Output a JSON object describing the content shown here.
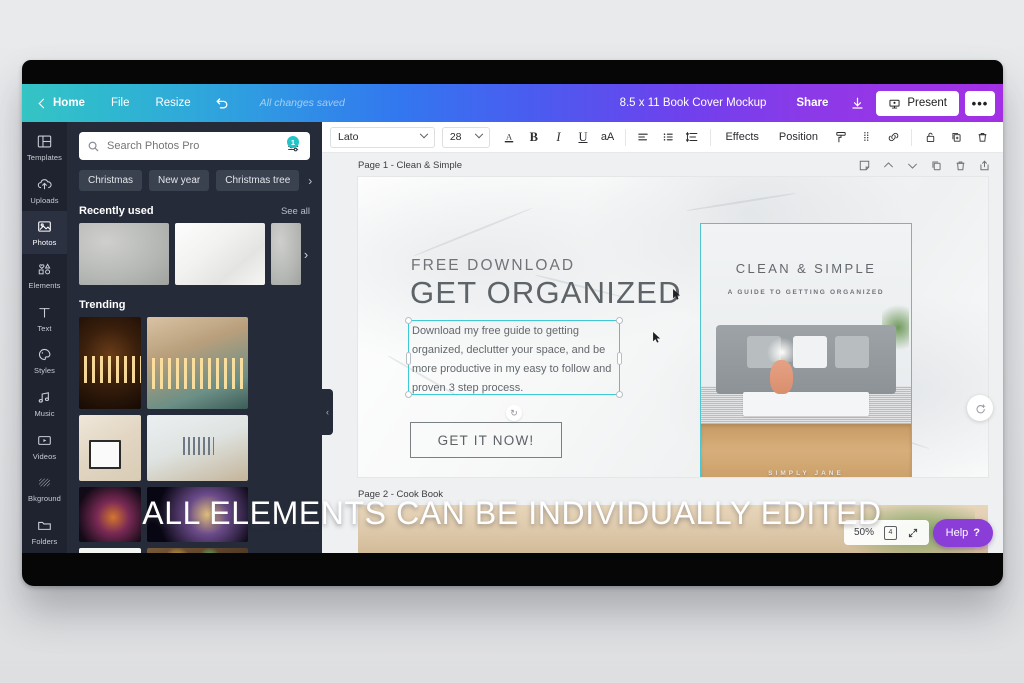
{
  "topbar": {
    "home": "Home",
    "file": "File",
    "resize": "Resize",
    "undo_icon": "undo-icon",
    "saved_status": "All changes saved",
    "doc_title": "8.5 x 11 Book Cover Mockup",
    "share": "Share",
    "download_icon": "download-icon",
    "present": "Present",
    "present_icon": "present-screen-icon",
    "more": "•••",
    "gradient_start": "#35c4c4",
    "gradient_mid": "#3278ef",
    "gradient_end": "#a32fe4"
  },
  "rail": {
    "items": [
      {
        "label": "Templates",
        "icon": "templates-icon",
        "active": false
      },
      {
        "label": "Uploads",
        "icon": "upload-cloud-icon",
        "active": false
      },
      {
        "label": "Photos",
        "icon": "photos-image-icon",
        "active": true
      },
      {
        "label": "Elements",
        "icon": "elements-shapes-icon",
        "active": false
      },
      {
        "label": "Text",
        "icon": "text-t-icon",
        "active": false
      },
      {
        "label": "Styles",
        "icon": "styles-palette-icon",
        "active": false
      },
      {
        "label": "Music",
        "icon": "music-note-icon",
        "active": false
      },
      {
        "label": "Videos",
        "icon": "video-play-icon",
        "active": false
      },
      {
        "label": "Bkground",
        "icon": "background-hatch-icon",
        "active": false
      },
      {
        "label": "Folders",
        "icon": "folder-icon",
        "active": false
      }
    ]
  },
  "panel": {
    "search": {
      "placeholder": "Search Photos Pro",
      "value": "",
      "search_icon": "search-icon",
      "filter_icon": "filter-sliders-icon",
      "filter_badge": "1"
    },
    "chips": [
      "Christmas",
      "New year",
      "Christmas tree"
    ],
    "chip_next_icon": "chevron-right-icon",
    "recently_used": {
      "title": "Recently used",
      "see_all": "See all",
      "thumbs": [
        "gray-marble-texture",
        "white-marble-texture"
      ]
    },
    "trending": {
      "title": "Trending",
      "thumbs": [
        "menorah-candles-dark",
        "girl-lighting-menorah",
        "happy-holidays-card",
        "menorah-on-table",
        "fireworks-colorful",
        "fireworks-gold",
        "happy-paper-letters",
        "bokeh-lights"
      ]
    },
    "collapse_icon": "chevron-left-icon"
  },
  "toolbar": {
    "font": "Lato",
    "font_size": "28",
    "text_color_icon": "text-color-a-icon",
    "bold": "B",
    "italic": "I",
    "underline": "U",
    "case": "aA",
    "align_icon": "text-align-icon",
    "list_icon": "bullet-list-icon",
    "spacing_icon": "line-spacing-icon",
    "effects": "Effects",
    "position": "Position",
    "copy_style_icon": "paint-roller-icon",
    "transparency_icon": "transparency-icon",
    "link_icon": "link-icon",
    "lock_icon": "lock-icon",
    "duplicate_icon": "duplicate-icon",
    "delete_icon": "trash-icon"
  },
  "canvas": {
    "page1": {
      "label": "Page 1 - Clean & Simple",
      "tools": [
        "note-icon",
        "move-up-icon",
        "move-down-icon",
        "duplicate-page-icon",
        "delete-page-icon",
        "export-page-icon"
      ],
      "eyebrow": "FREE DOWNLOAD",
      "headline": "GET ORGANIZED",
      "selected_text": "Download my free guide to getting organized, declutter your space, and be more productive in my easy to follow and proven 3 step process.",
      "cta": "GET IT NOW!",
      "selection_color": "#3ec9d6",
      "rotate_icon": "rotate-icon",
      "book": {
        "title": "CLEAN & SIMPLE",
        "subtitle": "A GUIDE TO GETTING ORGANIZED",
        "author": "SIMPLY JANE"
      }
    },
    "page2": {
      "label": "Page 2 - Cook Book"
    },
    "float_add_icon": "add-page-rotate-icon",
    "zoom_level": "50%",
    "page_count": "4",
    "fullscreen_icon": "fullscreen-expand-icon",
    "help_label": "Help",
    "help_mark": "?",
    "help_color": "#8b3dd8"
  },
  "overlay": {
    "caption": "ALL ELEMENTS CAN BE INDIVIDUALLY EDITED"
  }
}
